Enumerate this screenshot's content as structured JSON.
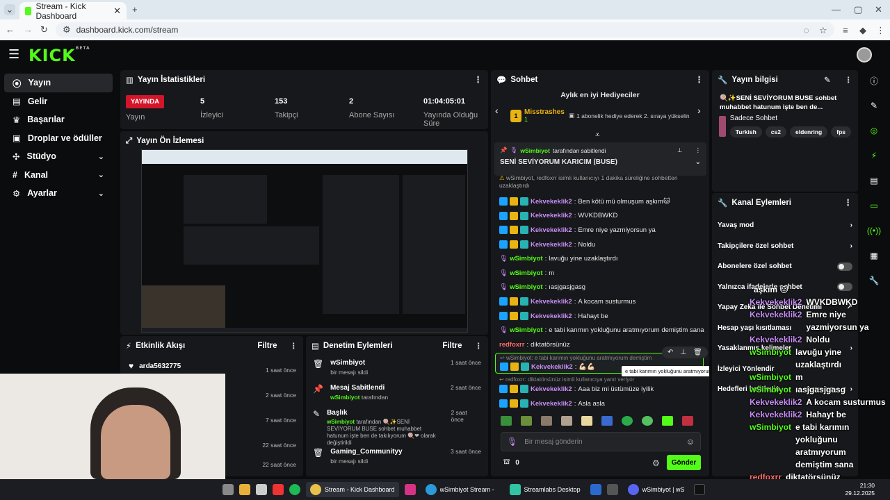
{
  "browser": {
    "tab_title": "Stream - Kick Dashboard",
    "url": "dashboard.kick.com/stream"
  },
  "sidebar": {
    "items": [
      {
        "label": "Yayın"
      },
      {
        "label": "Gelir"
      },
      {
        "label": "Başarılar"
      },
      {
        "label": "Droplar ve ödüller"
      },
      {
        "label": "Stüdyo"
      },
      {
        "label": "Kanal"
      },
      {
        "label": "Ayarlar"
      }
    ]
  },
  "stats": {
    "title": "Yayın İstatistikleri",
    "live_badge": "YAYINDA",
    "live_label": "Yayın",
    "viewers_value": "5",
    "viewers_label": "İzleyici",
    "followers_value": "153",
    "followers_label": "Takipçi",
    "subs_value": "2",
    "subs_label": "Abone Sayısı",
    "uptime_value": "01:04:05:01",
    "uptime_label": "Yayında Olduğu Süre"
  },
  "preview": {
    "title": "Yayın Ön İzlemesi"
  },
  "activity": {
    "title": "Etkinlik Akışı",
    "filter": "Filtre",
    "items": [
      {
        "name": "arda5632775",
        "time": "1 saat önce"
      },
      {
        "name": "",
        "time": "2 saat önce"
      },
      {
        "name": "",
        "time": "7 saat önce"
      },
      {
        "name": "",
        "time": "22 saat önce"
      },
      {
        "name": "",
        "time": "22 saat önce"
      }
    ]
  },
  "moderation": {
    "title": "Denetim Eylemleri",
    "filter": "Filtre",
    "items": [
      {
        "title": "wSimbiyot",
        "sub": "bir mesajı sildi",
        "time": "1 saat önce"
      },
      {
        "title": "Mesaj Sabitlendi",
        "sub_user": "wSimbiyot",
        "sub": "tarafından",
        "time": "2 saat önce"
      },
      {
        "title": "Başlık",
        "sub_user": "wSimbiyot",
        "sub": "tarafından 🍭✨SENİ SEVİYORUM BUSE sohbet muhabbet hatunum işte ben de takılıyorum 🍭❤ olarak değiştirildi",
        "time": "2 saat önce"
      },
      {
        "title": "Gaming_Communityy",
        "sub": "bir mesajı sildi",
        "time": "3 saat önce"
      }
    ]
  },
  "chat": {
    "title": "Sohbet",
    "gifters_title": "Aylık en iyi Hediyeciler",
    "top_gifter": "Misstrashes",
    "top_gifter_count": "1",
    "gifter_hint": "1 abonelik hediye ederek 2. sıraya yükselin",
    "pinned_by": "wSimbiyot",
    "pinned_by_suffix": "tarafından sabitlendi",
    "pinned_msg": "SENİ SEVİYORUM KARICIM (BUSE)",
    "system_msg": "wSimbiyot, redfoxrr isimli kullanıcıyı 1 dakika süreliğine sohbetten uzaklaştırdı",
    "messages": [
      {
        "user": "Kekvekeklik2",
        "text": "Ben kötü mü olmuşum aşkım🐱",
        "color": "#c68ef5",
        "badges": true
      },
      {
        "user": "Kekvekeklik2",
        "text": "WVKDBWKD",
        "color": "#c68ef5",
        "badges": true
      },
      {
        "user": "Kekvekeklik2",
        "text": "Emre niye yazmiyorsun ya",
        "color": "#c68ef5",
        "badges": true
      },
      {
        "user": "Kekvekeklik2",
        "text": "Noldu",
        "color": "#c68ef5",
        "badges": true
      },
      {
        "user": "wSimbiyot",
        "text": "lavuğu yine uzaklaştırdı",
        "color": "#53fc18",
        "badges": false
      },
      {
        "user": "wSimbiyot",
        "text": "m",
        "color": "#53fc18",
        "badges": false
      },
      {
        "user": "wSimbiyot",
        "text": "ıasjgasjgasg",
        "color": "#53fc18",
        "badges": false
      },
      {
        "user": "Kekvekeklik2",
        "text": "A kocam susturmus",
        "color": "#c68ef5",
        "badges": true
      },
      {
        "user": "Kekvekeklik2",
        "text": "Hahayt be",
        "color": "#c68ef5",
        "badges": true
      },
      {
        "user": "wSimbiyot",
        "text": "e tabi karımın yokluğunu aratmıyorum demiştim sana",
        "color": "#53fc18",
        "badges": false
      },
      {
        "user": "redfoxrr",
        "text": "diktatörsünüz",
        "color": "#ff6b6b",
        "badges": false
      }
    ],
    "reply1_quote": "wSimbiyot: e tabi karımın yokluğunu aratmıyorum demiştim",
    "reply1_user": "Kekvekeklik2",
    "reply1_text": "💪🏻💪🏻",
    "tooltip": "e tabi karımın yokluğunu aratmıyorum demiştim sana",
    "reply2_quote": "redfoxrr: diktatörsünüz isimli kullanıcıya yanıt veriyor",
    "reply2_user": "Kekvekeklik2",
    "reply2_text": "Aaa biz mi üstümüze iyilik",
    "last_user": "Kekvekeklik2",
    "last_text": "Asla asla",
    "input_placeholder": "Bir mesaj gönderin",
    "points": "0",
    "send_label": "Gönder"
  },
  "info": {
    "title": "Yayın bilgisi",
    "stream_title": "🍭✨SENİ SEVİYORUM BUSE sohbet muhabbet hatunum işte ben de...",
    "category": "Sadece Sohbet",
    "tags": [
      "Turkish",
      "cs2",
      "eldenring",
      "fps"
    ]
  },
  "channel_actions": {
    "title": "Kanal Eylemleri",
    "rows": [
      {
        "label": "Yavaş mod",
        "kind": "arrow"
      },
      {
        "label": "Takipçilere özel sohbet",
        "kind": "arrow"
      },
      {
        "label": "Abonelere özel sohbet",
        "kind": "toggle"
      },
      {
        "label": "Yalnızca ifadelerle sohbet",
        "kind": "toggle"
      },
      {
        "label": "Yapay Zeka ile Sohbet Denetimi",
        "kind": "link"
      },
      {
        "label": "Hesap yaşı kısıtlaması",
        "kind": "none"
      },
      {
        "label": "Yasaklanmış kelimeler",
        "kind": "arrow"
      },
      {
        "label": "İzleyici Yönlendir",
        "kind": "none"
      },
      {
        "label": "Hedefleri belirleyin",
        "kind": "arrow",
        "extra": "Aktif hedefler - 2"
      }
    ]
  },
  "overlay_chat": [
    {
      "user": "",
      "text": "aşkım 🐱"
    },
    {
      "user": "Kekvekeklik2",
      "text": "WVKDBWKD"
    },
    {
      "user": "Kekvekeklik2",
      "text": "Emre niye yazmiyorsun ya"
    },
    {
      "user": "Kekvekeklik2",
      "text": "Noldu"
    },
    {
      "user": "wSimbiyot",
      "text": "lavuğu yine uzaklaştırdı"
    },
    {
      "user": "wSimbiyot",
      "text": "m"
    },
    {
      "user": "wSimbiyot",
      "text": "ıasjgasjgasg"
    },
    {
      "user": "Kekvekeklik2",
      "text": "A kocam susturmus"
    },
    {
      "user": "Kekvekeklik2",
      "text": "Hahayt be"
    },
    {
      "user": "wSimbiyot",
      "text": "e tabi karımın yokluğunu aratmıyorum demiştim sana"
    },
    {
      "user": "redfoxrr",
      "text": "diktatörsünüz"
    },
    {
      "user": "Kekvekeklik2",
      "text": "Asla asla"
    }
  ],
  "taskbar": {
    "apps": [
      "Stream - Kick Dashboard",
      "wSimbiyot Stream - Wa",
      "Streamlabs Desktop",
      "wSimbiyot | wS"
    ],
    "time": "21:30",
    "date": "29.12.2025"
  },
  "colors": {
    "accent": "#53fc18",
    "live": "#d3152a",
    "panel": "#17181b"
  }
}
